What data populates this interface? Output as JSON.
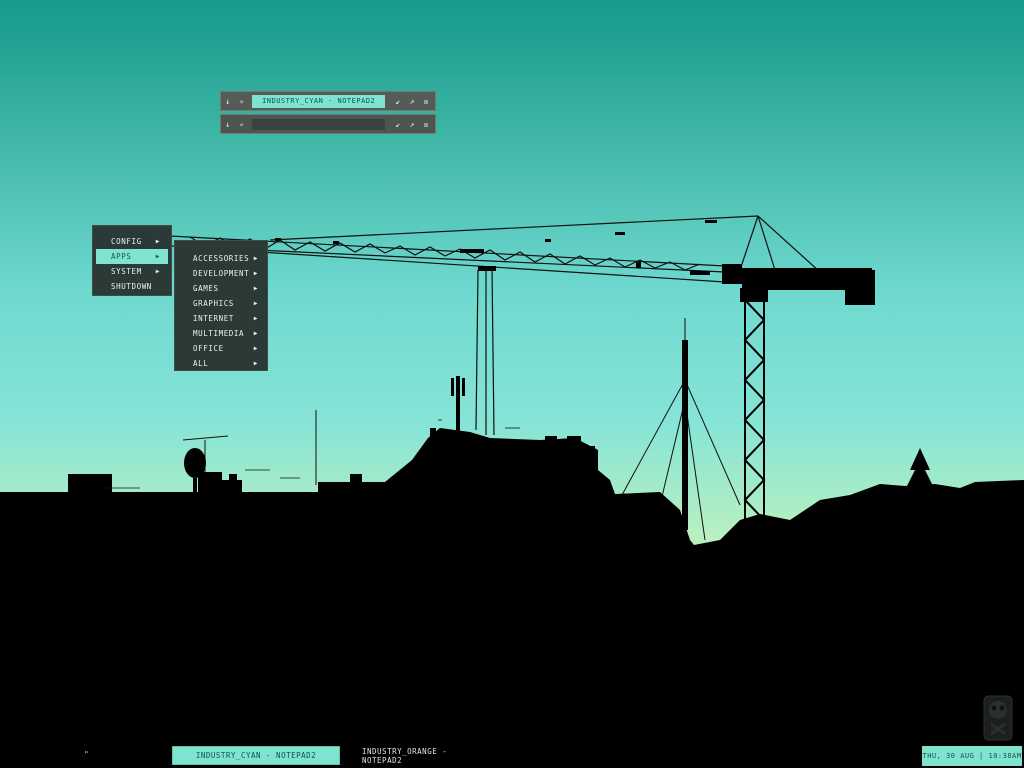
{
  "windows": [
    {
      "title": "industry_cyan - notepad2",
      "buttons": {
        "shade": "↓",
        "sticky": "✧",
        "iconify": "↙",
        "maximize": "↗",
        "close": "☒"
      }
    },
    {
      "title": "",
      "buttons": {
        "shade": "↓",
        "sticky": "✧",
        "iconify": "↙",
        "maximize": "↗",
        "close": "☒"
      }
    }
  ],
  "menu": {
    "main": [
      {
        "label": "config",
        "arrow": "▶"
      },
      {
        "label": "apps",
        "arrow": "▶",
        "active": true
      },
      {
        "label": "system",
        "arrow": "▶"
      },
      {
        "label": "shutdown",
        "arrow": ""
      }
    ],
    "apps_submenu": [
      {
        "label": "accessories",
        "arrow": "▶"
      },
      {
        "label": "development",
        "arrow": "▶"
      },
      {
        "label": "games",
        "arrow": "▶"
      },
      {
        "label": "graphics",
        "arrow": "▶"
      },
      {
        "label": "internet",
        "arrow": "▶"
      },
      {
        "label": "multimedia",
        "arrow": "▶"
      },
      {
        "label": "office",
        "arrow": "▶"
      },
      {
        "label": "all",
        "arrow": "▶"
      }
    ]
  },
  "taskbar": {
    "left_glyph": "\"",
    "tasks": [
      {
        "label": "industry_cyan - notepad2",
        "active": true
      },
      {
        "label": "industry_orange - notepad2",
        "active": false
      }
    ],
    "clock": "thu, 30 aug | 10:38am"
  },
  "icons": {
    "trash": "trash-can-icon"
  },
  "colors": {
    "accent": "#7ee3cf",
    "menu_bg": "#2b3a37",
    "skyline": "#000000"
  }
}
